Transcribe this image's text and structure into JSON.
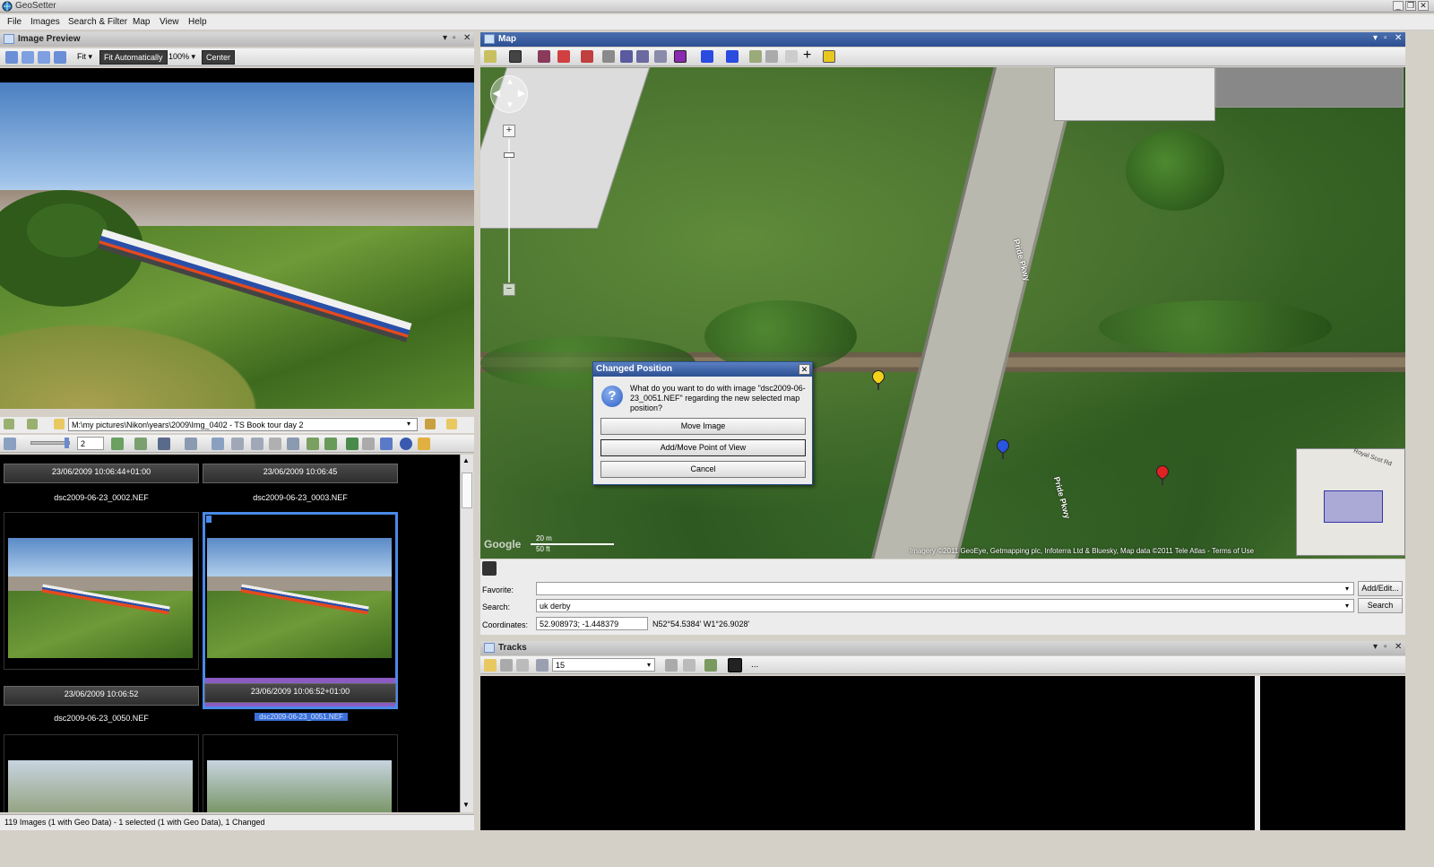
{
  "window": {
    "title": "GeoSetter"
  },
  "menu": [
    "File",
    "Images",
    "Search & Filter",
    "Map",
    "View",
    "Help"
  ],
  "preview": {
    "title": "Image Preview",
    "toolbar": {
      "fit_label": "Fit",
      "fit_auto_label": "Fit Automatically",
      "zoom_value": "100%",
      "center_label": "Center"
    }
  },
  "path": {
    "value": "M:\\my pictures\\Nikon\\years\\2009\\Img_0402 - TS Book tour day 2"
  },
  "thumb_toolbar": {
    "size_value": "2"
  },
  "thumbnails": [
    {
      "caption": "23/06/2009 10:06:44+01:00",
      "name": "dsc2009-06-23_0002.NEF"
    },
    {
      "caption": "23/06/2009 10:06:45",
      "name": "dsc2009-06-23_0003.NEF"
    },
    {
      "caption": "23/06/2009 10:06:52",
      "name": "dsc2009-06-23_0050.NEF"
    },
    {
      "caption": "23/06/2009 10:06:52+01:00",
      "name": "dsc2009-06-23_0051.NEF"
    }
  ],
  "status": {
    "text": "119 Images (1 with Geo Data) - 1 selected (1 with Geo Data), 1 Changed"
  },
  "map": {
    "title": "Map",
    "road_label_1": "Pride Pkwy",
    "road_label_2": "Pride Pkwy",
    "minimap_label": "Royal Scot Rd",
    "scale_top": "20 m",
    "scale_bottom": "50 ft",
    "copyright": "Imagery ©2011 GeoEye, Getmapping plc, Infoterra Ltd & Bluesky, Map data ©2011 Tele Atlas - Terms of Use",
    "google_logo": "Google"
  },
  "dialog": {
    "title": "Changed Position",
    "message": "What do you want to do with image \"dsc2009-06-23_0051.NEF\" regarding the new selected map position?",
    "buttons": [
      "Move Image",
      "Add/Move Point of View",
      "Cancel"
    ]
  },
  "search": {
    "favorite_label": "Favorite:",
    "favorite_value": "",
    "add_edit_label": "Add/Edit...",
    "search_label": "Search:",
    "search_value": "uk derby",
    "search_button": "Search",
    "coords_label": "Coordinates:",
    "coords_decimal": "52.908973; -1.448379",
    "coords_dms": "N52°54.5384' W1°26.9028'"
  },
  "tracks": {
    "title": "Tracks",
    "value": "15",
    "more": "..."
  },
  "colors": {
    "panel_header": "#2c4f91",
    "selection": "#4a8ae8",
    "pin_yellow": "#f3d11a",
    "pin_blue": "#2a55e0",
    "pin_red": "#e02222"
  }
}
